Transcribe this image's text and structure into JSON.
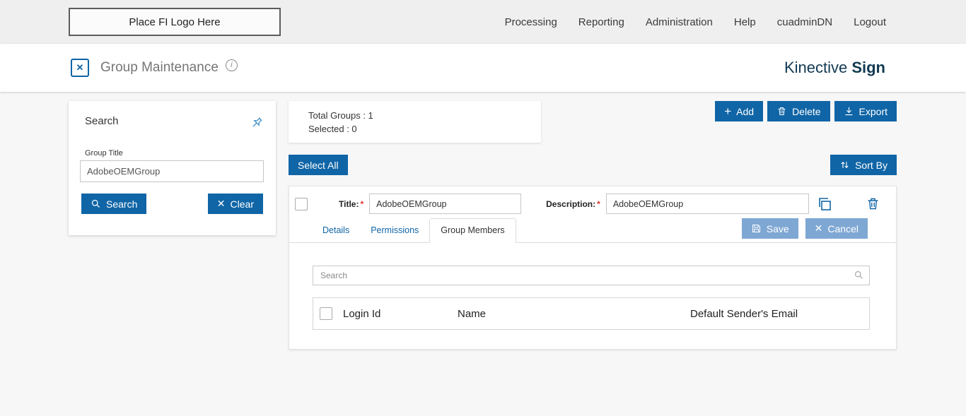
{
  "topbar": {
    "logo_text": "Place FI Logo Here",
    "nav": [
      {
        "label": "Processing"
      },
      {
        "label": "Reporting"
      },
      {
        "label": "Administration"
      },
      {
        "label": "Help"
      },
      {
        "label": "cuadminDN"
      },
      {
        "label": "Logout"
      }
    ]
  },
  "header": {
    "title": "Group Maintenance",
    "info_icon": "i",
    "brand_regular": "Kinective ",
    "brand_bold": "Sign"
  },
  "search_panel": {
    "title": "Search",
    "group_title_label": "Group Title",
    "group_title_value": "AdobeOEMGroup",
    "search_button": "Search",
    "clear_button": "Clear",
    "clear_x": "✕"
  },
  "summary": {
    "total_groups": "Total Groups : 1",
    "selected": "Selected : 0"
  },
  "toolbar": {
    "add": "Add",
    "add_plus": "+",
    "delete": "Delete",
    "export": "Export",
    "select_all": "Select All",
    "sort_by": "Sort By"
  },
  "group_row": {
    "title_label": "Title:",
    "title_value": "AdobeOEMGroup",
    "description_label": "Description:",
    "description_value": "AdobeOEMGroup",
    "required_marker": "*",
    "tabs": [
      {
        "label": "Details"
      },
      {
        "label": "Permissions"
      },
      {
        "label": "Group Members"
      }
    ],
    "active_tab": "Group Members",
    "save_button": "Save",
    "cancel_button": "Cancel",
    "cancel_x": "✕",
    "members": {
      "search_placeholder": "Search",
      "columns": [
        "Login Id",
        "Name",
        "Default Sender's Email"
      ]
    }
  },
  "colors": {
    "primary_blue": "#1065a6",
    "muted_blue": "#7fa7d3",
    "brand_navy": "#123a52",
    "topbar_bg": "#f0eff0",
    "required_red": "#e03131"
  }
}
